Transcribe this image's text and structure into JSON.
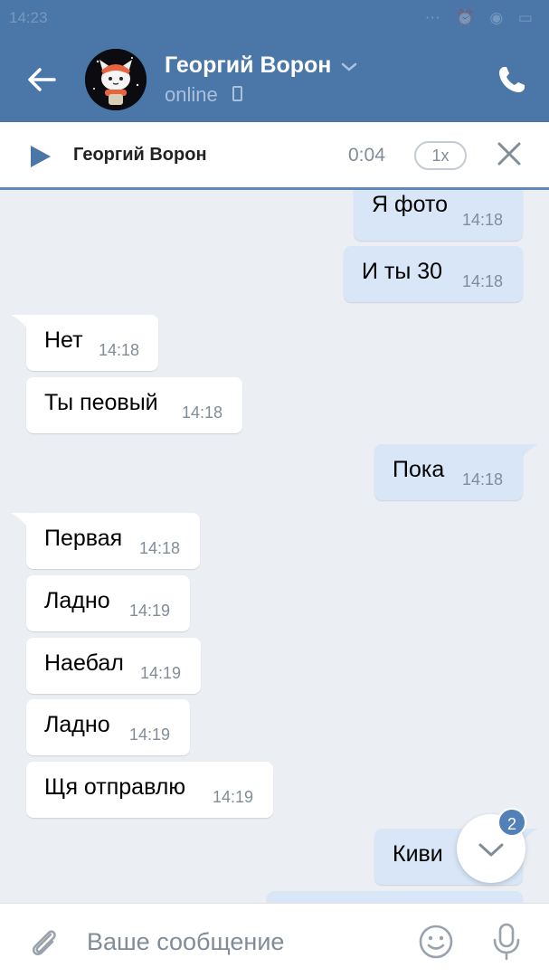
{
  "status_bar": {
    "time": "14:23",
    "icons": "⋯ ⏰ ◉ ▭"
  },
  "header": {
    "contact_name": "Георгий Ворон",
    "status": "online"
  },
  "player": {
    "name": "Георгий Ворон",
    "time": "0:04",
    "speed": "1x"
  },
  "messages": [
    {
      "dir": "out",
      "text": "Я фото",
      "time": "14:18"
    },
    {
      "dir": "out",
      "text": "И ты 30",
      "time": "14:18"
    },
    {
      "dir": "in",
      "text": "Нет",
      "time": "14:18"
    },
    {
      "dir": "in",
      "text": "Ты пеовый",
      "time": "14:18"
    },
    {
      "dir": "out",
      "text": "Пока",
      "time": "14:18"
    },
    {
      "dir": "in",
      "text": "Первая",
      "time": "14:18"
    },
    {
      "dir": "in",
      "text": "Ладно",
      "time": "14:19"
    },
    {
      "dir": "in",
      "text": "Наебал",
      "time": "14:19"
    },
    {
      "dir": "in",
      "text": "Ладно",
      "time": "14:19"
    },
    {
      "dir": "in",
      "text": "Щя отправлю",
      "time": "14:19"
    },
    {
      "dir": "out",
      "text": "Киви",
      "time": ""
    }
  ],
  "scroll_down": {
    "unread_count": "2"
  },
  "input": {
    "placeholder": "Ваше сообщение"
  },
  "colors": {
    "header": "#4a76a8",
    "outgoing": "#d8e6f7",
    "incoming": "#ffffff",
    "badge": "#5181b8"
  },
  "icons": [
    "back-arrow-icon",
    "chevron-down-icon",
    "phone-icon",
    "play-icon",
    "close-icon",
    "chevron-down-icon",
    "paperclip-icon",
    "smile-icon",
    "microphone-icon"
  ]
}
